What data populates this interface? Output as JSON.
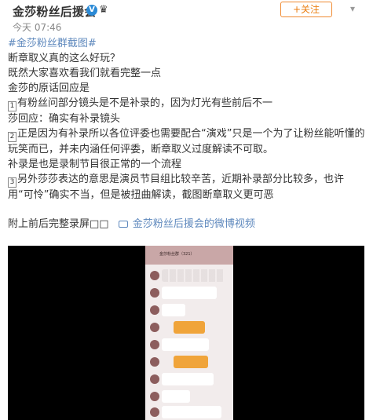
{
  "header": {
    "author": "金莎粉丝后援会",
    "time": "今天 07:46",
    "follow_label": "+关注",
    "more_icon": "chevron-down-icon",
    "verified_icon": "verified-v-icon",
    "vip_icon": "vip-crown-icon"
  },
  "post": {
    "hashtag": "#金莎粉丝群截图#",
    "lines": [
      "断章取义真的这么好玩？",
      "既然大家喜欢看我们就看完整一点",
      "金莎的原话回应是"
    ],
    "point1_num": "1",
    "point1": "有粉丝问部分镜头是不是补录的，因为灯光有些前后不一",
    "reply1": "莎回应：确实有补录镜头",
    "point2_num": "2",
    "point2": "正是因为有补录所以各位评委也需要配合“演戏”只是一个为了让粉丝能听懂的玩笑而已，并未内涵任何评委，断章取义过度解读不可取。",
    "note": "补录是也是录制节目很正常的一个流程",
    "point3_num": "3",
    "point3": "另外莎莎表达的意思是演员节目组比较辛苦，近期补录部分比较多，也许用“可怜”确实不当，但是被扭曲解读，截图断章取义更可恶",
    "footer_text": "附上前后完整录屏",
    "footer_boxes": "□□",
    "video_link": "金莎粉丝后援会的微博视频"
  },
  "video": {
    "phone_title": "金莎粉丝群（321）"
  },
  "colors": {
    "link": "#5e88bd",
    "follow": "#eb7e10",
    "bubble_accent": "#f0a43a"
  }
}
